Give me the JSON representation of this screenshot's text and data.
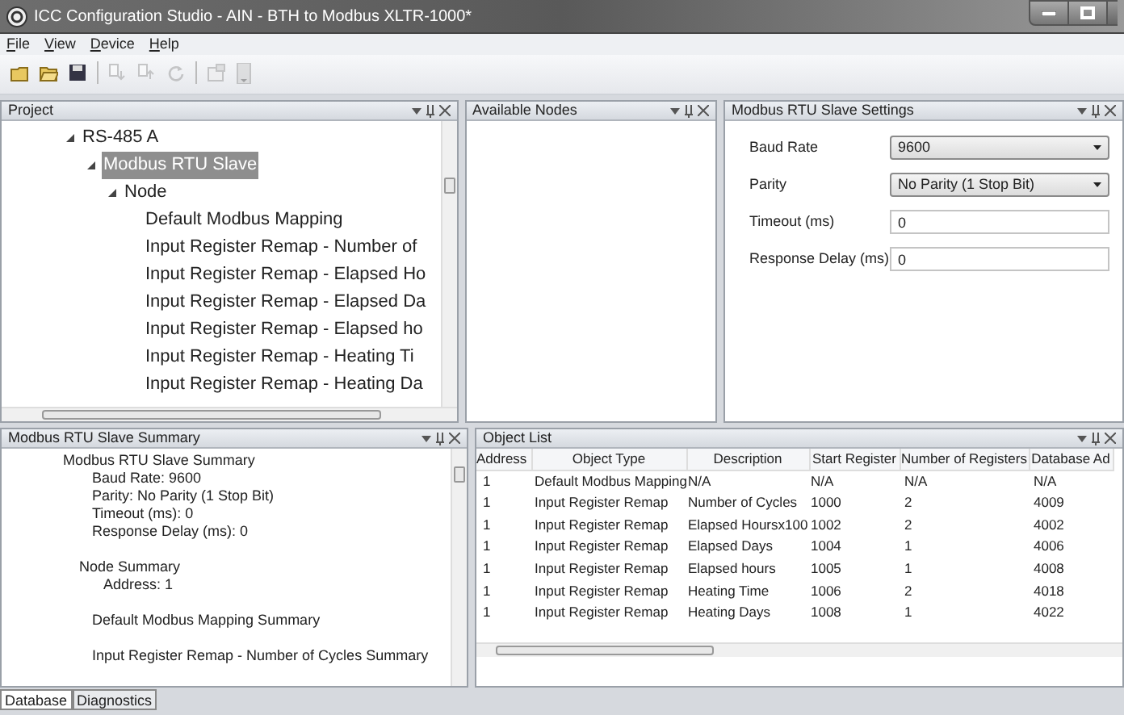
{
  "window": {
    "title": "ICC Configuration Studio - AIN - BTH to Modbus XLTR-1000*"
  },
  "menu": [
    {
      "label": "File"
    },
    {
      "label": "View"
    },
    {
      "label": "Device"
    },
    {
      "label": "Help"
    }
  ],
  "toolbar": [
    {
      "kind": "new",
      "disabled": false
    },
    {
      "kind": "open",
      "disabled": false
    },
    {
      "kind": "save",
      "disabled": false
    },
    {
      "kind": "sep"
    },
    {
      "kind": "download",
      "disabled": true
    },
    {
      "kind": "upload",
      "disabled": true
    },
    {
      "kind": "reset",
      "disabled": true
    },
    {
      "kind": "sep"
    },
    {
      "kind": "device",
      "disabled": true
    },
    {
      "kind": "more",
      "disabled": true
    }
  ],
  "project": {
    "title": "Project",
    "tree": [
      {
        "label": "RS-485 A",
        "expanded": true,
        "selected": false,
        "children": [
          {
            "label": "Modbus RTU Slave",
            "expanded": true,
            "selected": true,
            "children": [
              {
                "label": "Node",
                "expanded": true,
                "selected": false,
                "children": [
                  {
                    "label": "Default Modbus Mapping",
                    "selected": false
                  },
                  {
                    "label": "Input Register Remap - Number of",
                    "selected": false
                  },
                  {
                    "label": "Input Register Remap - Elapsed Ho",
                    "selected": false
                  },
                  {
                    "label": "Input Register Remap - Elapsed Da",
                    "selected": false
                  },
                  {
                    "label": "Input Register Remap - Elapsed ho",
                    "selected": false
                  },
                  {
                    "label": "Input Register Remap - Heating Ti",
                    "selected": false
                  },
                  {
                    "label": "Input Register Remap - Heating Da",
                    "selected": false
                  }
                ]
              }
            ]
          }
        ]
      }
    ]
  },
  "available_nodes": {
    "title": "Available Nodes"
  },
  "settings": {
    "title": "Modbus RTU Slave Settings",
    "fields": [
      {
        "kind": "dropdown",
        "label": "Baud Rate",
        "value": "9600"
      },
      {
        "kind": "dropdown",
        "label": "Parity",
        "value": "No Parity (1 Stop Bit)"
      },
      {
        "kind": "text",
        "label": "Timeout (ms)",
        "value": "0"
      },
      {
        "kind": "text",
        "label": "Response Delay (ms)",
        "value": "0"
      }
    ]
  },
  "summary": {
    "title": "Modbus RTU Slave Summary",
    "lines": [
      {
        "text": "Modbus RTU Slave Summary",
        "children": [
          {
            "text": "Baud Rate: 9600"
          },
          {
            "text": "Parity: No Parity (1 Stop Bit)"
          },
          {
            "text": "Timeout (ms): 0"
          },
          {
            "text": "Response Delay (ms): 0"
          }
        ]
      },
      {
        "text": "Node Summary",
        "children": [
          {
            "text": "Address: 1"
          }
        ]
      },
      {
        "text": "Default Modbus Mapping Summary"
      },
      {
        "text": "Input Register Remap - Number of Cycles Summary"
      }
    ]
  },
  "object_list": {
    "title": "Object List",
    "columns": [
      "Address",
      "Object Type",
      "Description",
      "Start Register",
      "Number of Registers",
      "Database Ad"
    ],
    "rows": [
      [
        "1",
        "Default Modbus Mapping",
        "N/A",
        "N/A",
        "N/A",
        "N/A"
      ],
      [
        "1",
        "Input Register Remap",
        "Number of Cycles",
        "1000",
        "2",
        "4009"
      ],
      [
        "1",
        "Input Register Remap",
        "Elapsed Hoursx100",
        "1002",
        "2",
        "4002"
      ],
      [
        "1",
        "Input Register Remap",
        "Elapsed Days",
        "1004",
        "1",
        "4006"
      ],
      [
        "1",
        "Input Register Remap",
        "Elapsed hours",
        "1005",
        "1",
        "4008"
      ],
      [
        "1",
        "Input Register Remap",
        "Heating Time",
        "1006",
        "2",
        "4018"
      ],
      [
        "1",
        "Input Register Remap",
        "Heating Days",
        "1008",
        "1",
        "4022"
      ]
    ]
  },
  "bottom_tabs": [
    {
      "label": "Database",
      "selected": true
    },
    {
      "label": "Diagnostics",
      "selected": false
    }
  ]
}
